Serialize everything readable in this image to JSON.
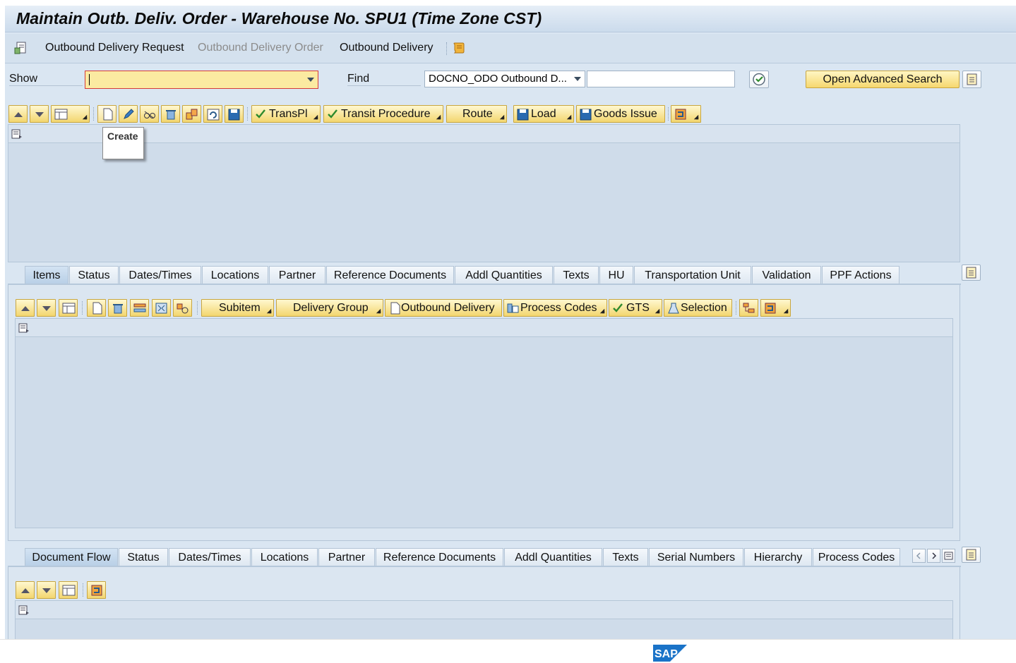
{
  "window": {
    "title": "Maintain Outb. Deliv. Order - Warehouse No. SPU1 (Time Zone CST)"
  },
  "app_toolbar": {
    "links": [
      {
        "label": "Outbound Delivery Request",
        "enabled": true
      },
      {
        "label": "Outbound Delivery Order",
        "enabled": false
      },
      {
        "label": "Outbound Delivery",
        "enabled": true
      }
    ]
  },
  "search": {
    "show_label": "Show",
    "show_value": "",
    "find_label": "Find",
    "find_value": "DOCNO_ODO Outbound D...",
    "find_text": "",
    "advanced_label": "Open Advanced Search"
  },
  "header_toolbar": {
    "transpl": "TransPl",
    "transit": "Transit Procedure",
    "route": "Route",
    "load": "Load",
    "goods_issue": "Goods Issue"
  },
  "tooltip": {
    "text": "Create"
  },
  "item_tabs": [
    "Items",
    "Status",
    "Dates/Times",
    "Locations",
    "Partner",
    "Reference Documents",
    "Addl Quantities",
    "Texts",
    "HU",
    "Transportation Unit",
    "Validation",
    "PPF Actions"
  ],
  "item_toolbar": {
    "subitem": "Subitem",
    "delivery_group": "Delivery Group",
    "outbound_delivery": "Outbound Delivery",
    "process_codes": "Process Codes",
    "gts": "GTS",
    "selection": "Selection"
  },
  "doc_tabs": [
    "Document Flow",
    "Status",
    "Dates/Times",
    "Locations",
    "Partner",
    "Reference Documents",
    "Addl Quantities",
    "Texts",
    "Serial Numbers",
    "Hierarchy",
    "Process Codes"
  ],
  "footer": {
    "logo": "SAP"
  },
  "colors": {
    "accent": "#f6d86e",
    "background": "#dae6f2",
    "sap_blue": "#1a73c8"
  }
}
